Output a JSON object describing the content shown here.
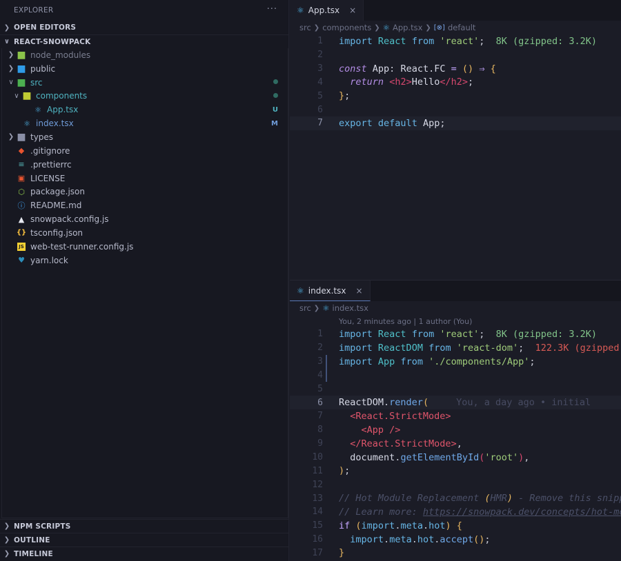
{
  "sidebar": {
    "title": "EXPLORER",
    "more": "···",
    "open_editors": "OPEN EDITORS",
    "project": "REACT-SNOWPACK",
    "tree": [
      {
        "name": "node_modules",
        "type": "folder",
        "depth": 1,
        "expanded": false,
        "icon": "folder-node-icon",
        "color": "#7a7e90"
      },
      {
        "name": "public",
        "type": "folder",
        "depth": 1,
        "expanded": false,
        "icon": "folder-public-icon",
        "color": "#b7bacb"
      },
      {
        "name": "src",
        "type": "folder",
        "depth": 1,
        "expanded": true,
        "icon": "folder-src-icon",
        "color": "#4fb3c0",
        "badge": "dot"
      },
      {
        "name": "components",
        "type": "folder",
        "depth": 2,
        "expanded": true,
        "icon": "folder-components-icon",
        "color": "#4fb3c0",
        "badge": "dot"
      },
      {
        "name": "App.tsx",
        "type": "file",
        "depth": 3,
        "icon": "react-icon",
        "color": "#4fb3c0",
        "badge": "U"
      },
      {
        "name": "index.tsx",
        "type": "file",
        "depth": 2,
        "icon": "react-icon",
        "color": "#6f9bd8",
        "badge": "M"
      },
      {
        "name": "types",
        "type": "folder",
        "depth": 1,
        "expanded": false,
        "icon": "folder-icon",
        "color": "#b7bacb"
      },
      {
        "name": ".gitignore",
        "type": "file",
        "depth": 1,
        "icon": "git-icon",
        "color": "#b7bacb"
      },
      {
        "name": ".prettierrc",
        "type": "file",
        "depth": 1,
        "icon": "prettier-icon",
        "color": "#b7bacb"
      },
      {
        "name": "LICENSE",
        "type": "file",
        "depth": 1,
        "icon": "license-icon",
        "color": "#b7bacb"
      },
      {
        "name": "package.json",
        "type": "file",
        "depth": 1,
        "icon": "nodejs-icon",
        "color": "#b7bacb"
      },
      {
        "name": "README.md",
        "type": "file",
        "depth": 1,
        "icon": "info-icon",
        "color": "#b7bacb"
      },
      {
        "name": "snowpack.config.js",
        "type": "file",
        "depth": 1,
        "icon": "snowpack-icon",
        "color": "#b7bacb"
      },
      {
        "name": "tsconfig.json",
        "type": "file",
        "depth": 1,
        "icon": "json-braces-icon",
        "color": "#b7bacb"
      },
      {
        "name": "web-test-runner.config.js",
        "type": "file",
        "depth": 1,
        "icon": "js-icon",
        "color": "#b7bacb"
      },
      {
        "name": "yarn.lock",
        "type": "file",
        "depth": 1,
        "icon": "yarn-icon",
        "color": "#b7bacb"
      }
    ],
    "bottom_sections": [
      "NPM SCRIPTS",
      "OUTLINE",
      "TIMELINE"
    ]
  },
  "editor1": {
    "tab": "App.tsx",
    "close": "×",
    "breadcrumb": [
      "src",
      "components",
      "App.tsx",
      "default"
    ],
    "active_line": 7
  },
  "editor2": {
    "tab": "index.tsx",
    "close": "×",
    "breadcrumb": [
      "src",
      "index.tsx"
    ],
    "blame_header": "You, 2 minutes ago | 1 author (You)",
    "active_line": 6,
    "inline_blame": "You, a day ago • initial"
  },
  "colors": {
    "keyword": "#67b6e6",
    "class": "#4fc0c9",
    "string": "#9fcc7a",
    "import_cost_ok": "#82c58a",
    "import_cost_heavy": "#d85a55",
    "jsx_tag": "#e0556b",
    "comment": "#4b5068",
    "git_untracked": "#4fb3c0",
    "git_modified": "#6f9bd8"
  }
}
